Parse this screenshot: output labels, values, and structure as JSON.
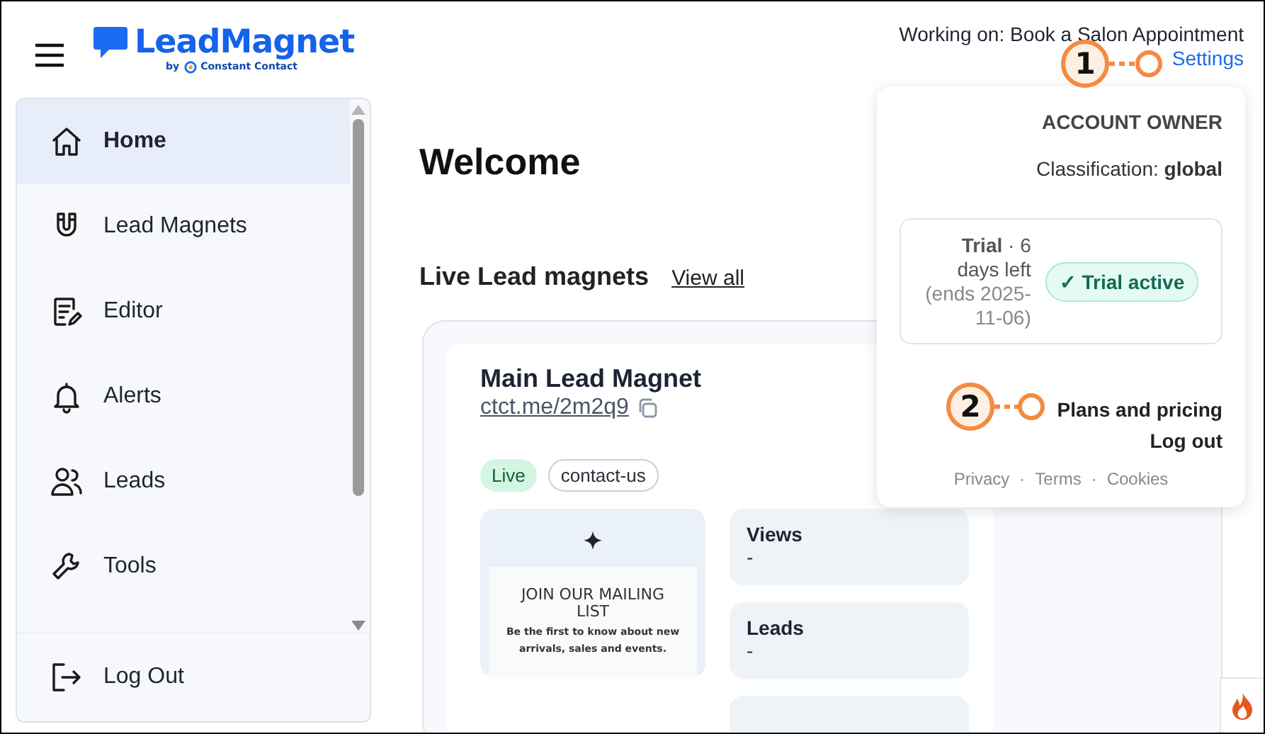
{
  "header": {
    "logo_text": "LeadMagnet",
    "byline_prefix": "by",
    "byline_brand": "Constant Contact",
    "working_on": "Working on: Book a Salon Appointment",
    "settings_link": "Settings"
  },
  "sidebar": {
    "items": [
      {
        "label": "Home",
        "selected": true
      },
      {
        "label": "Lead Magnets",
        "selected": false
      },
      {
        "label": "Editor",
        "selected": false
      },
      {
        "label": "Alerts",
        "selected": false
      },
      {
        "label": "Leads",
        "selected": false
      },
      {
        "label": "Tools",
        "selected": false
      }
    ],
    "logout": "Log Out"
  },
  "main": {
    "title": "Welcome",
    "section_title": "Live Lead magnets",
    "view_all": "View all",
    "card": {
      "title": "Main Lead Magnet",
      "link": "ctct.me/2m2q9",
      "tags": [
        {
          "label": "Live",
          "kind": "status"
        },
        {
          "label": "contact-us",
          "kind": "category"
        }
      ],
      "preview": {
        "heading": "JOIN OUR MAILING LIST",
        "text": "Be the first to know about new arrivals, sales and events."
      },
      "stats": [
        {
          "label": "Views",
          "value": "-"
        },
        {
          "label": "Leads",
          "value": "-"
        }
      ]
    }
  },
  "account_menu": {
    "role": "ACCOUNT OWNER",
    "classification": "Classification: **global**",
    "trial": {
      "summary": "**Trial**  · 6 days left",
      "ends": "(ends 2025-11-06)",
      "badge": "✓ Trial active"
    },
    "links": [
      "Plans and pricing",
      "Log out"
    ],
    "footer": [
      "Privacy",
      "Terms",
      "Cookies"
    ],
    "footer_separator": "·"
  },
  "callouts": [
    {
      "number": "1"
    },
    {
      "number": "2"
    }
  ]
}
